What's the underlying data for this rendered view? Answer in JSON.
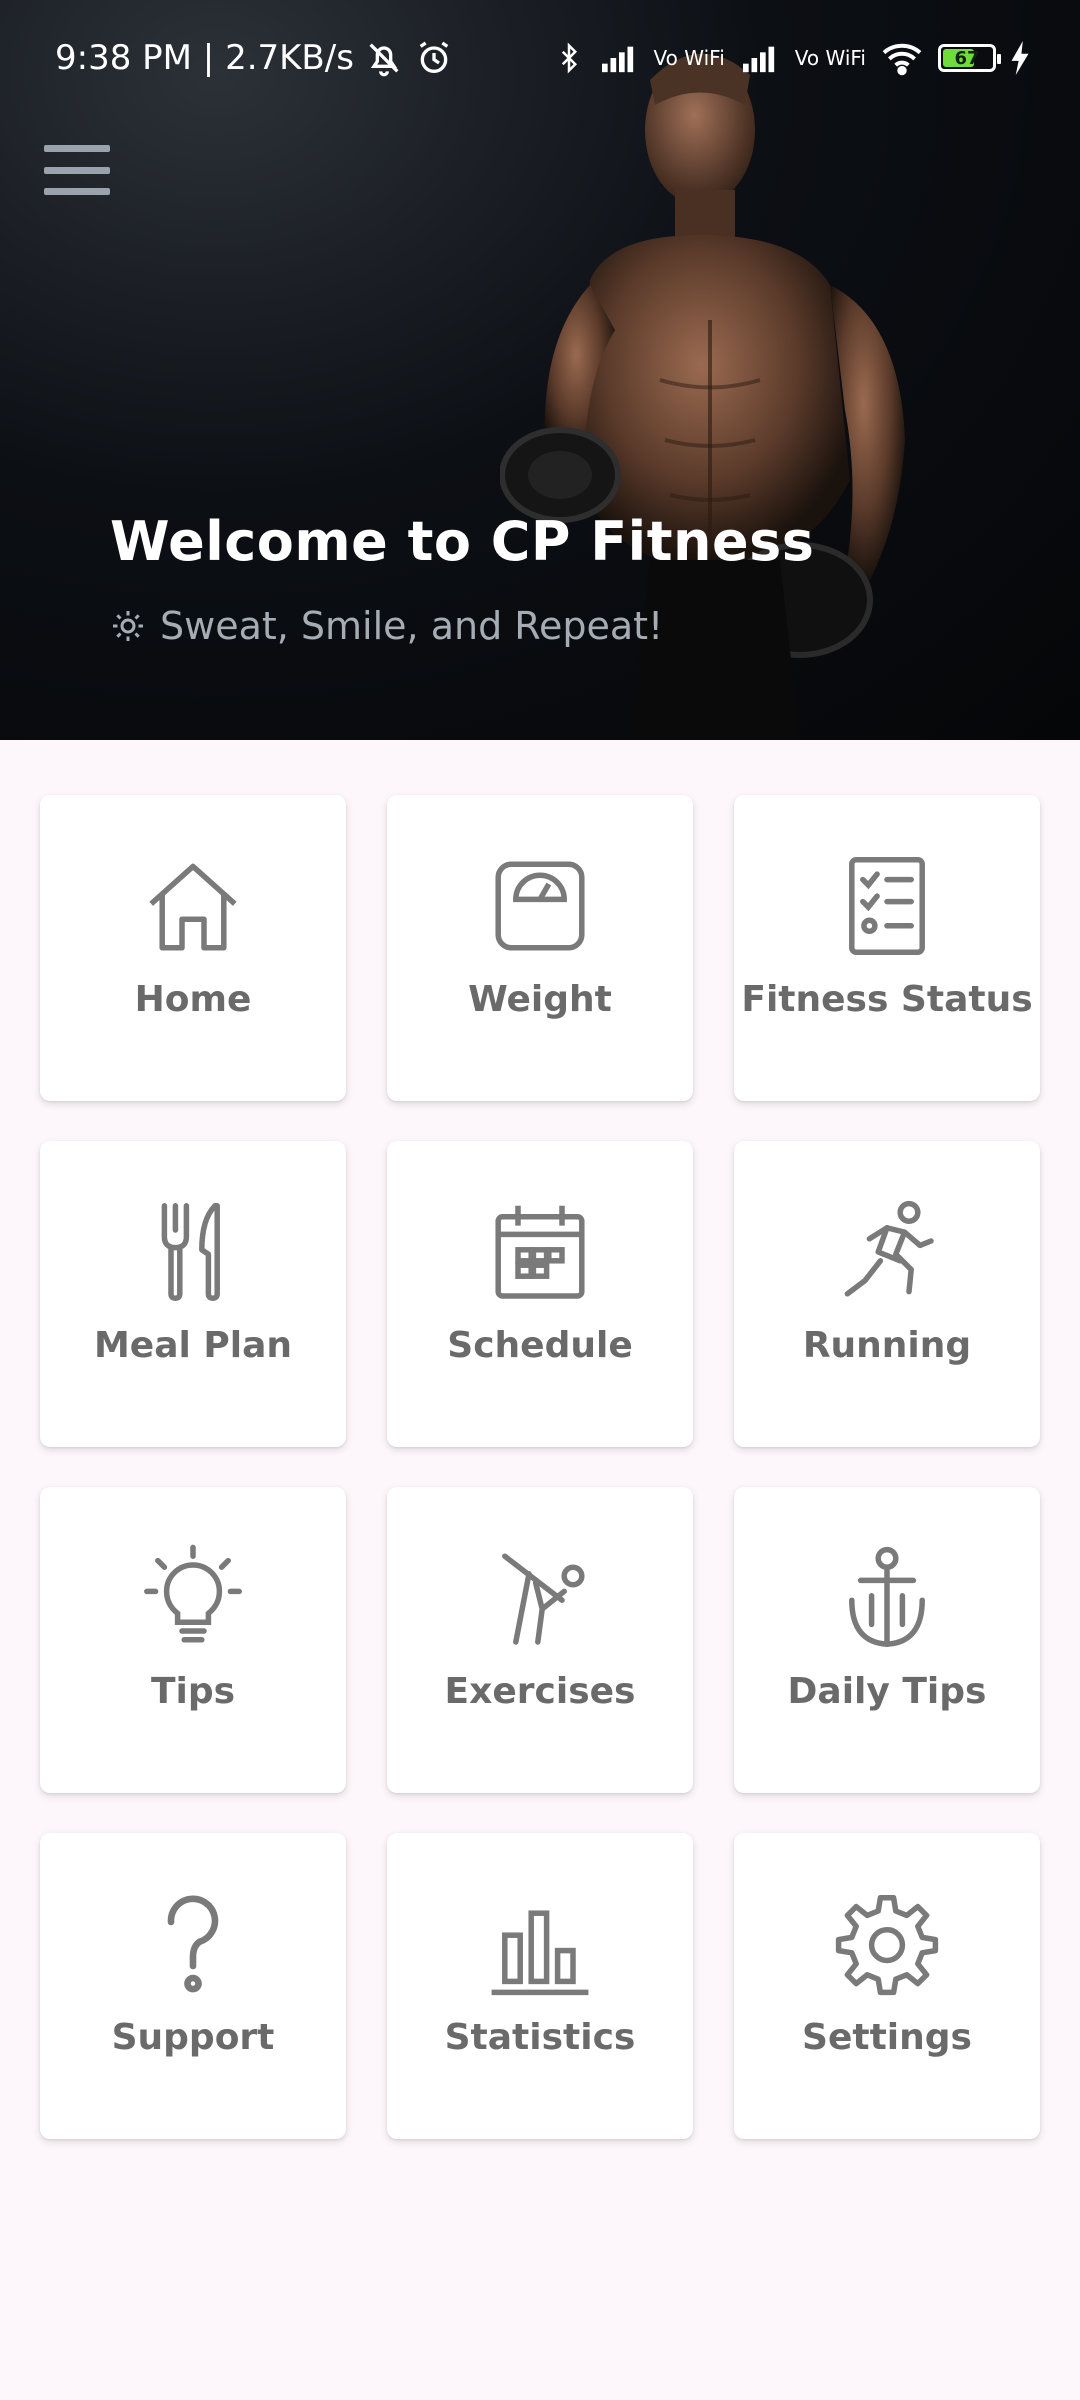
{
  "status_bar": {
    "time_speed": "9:38 PM | 2.7KB/s",
    "vowifi_1": "Vo WiFi",
    "vowifi_2": "Vo WiFi",
    "battery": "67",
    "battery_level_percent": 67,
    "icons": [
      "mute-icon",
      "alarm-icon",
      "bluetooth-icon",
      "signal-icon",
      "wifi-icon",
      "battery-icon",
      "charging-icon"
    ]
  },
  "header": {
    "title": "Welcome to CP Fitness",
    "tagline": "Sweat, Smile, and Repeat!",
    "menu_icon": "hamburger-icon",
    "tagline_icon": "gear-icon"
  },
  "tiles": [
    {
      "label": "Home",
      "icon": "home-icon"
    },
    {
      "label": "Weight",
      "icon": "scale-icon"
    },
    {
      "label": "Fitness Status",
      "icon": "checklist-icon"
    },
    {
      "label": "Meal Plan",
      "icon": "cutlery-icon"
    },
    {
      "label": "Schedule",
      "icon": "calendar-icon"
    },
    {
      "label": "Running",
      "icon": "runner-icon"
    },
    {
      "label": "Tips",
      "icon": "lightbulb-icon"
    },
    {
      "label": "Exercises",
      "icon": "exercise-icon"
    },
    {
      "label": "Daily Tips",
      "icon": "anchor-icon"
    },
    {
      "label": "Support",
      "icon": "question-icon"
    },
    {
      "label": "Statistics",
      "icon": "bar-chart-icon"
    },
    {
      "label": "Settings",
      "icon": "gear-icon"
    }
  ],
  "colors": {
    "background": "#fdf7fb",
    "tile": "#ffffff",
    "icon": "#7a7a7a",
    "label": "#6a6a6a",
    "header_text": "#ffffff",
    "tagline_text": "#a5acb4"
  }
}
